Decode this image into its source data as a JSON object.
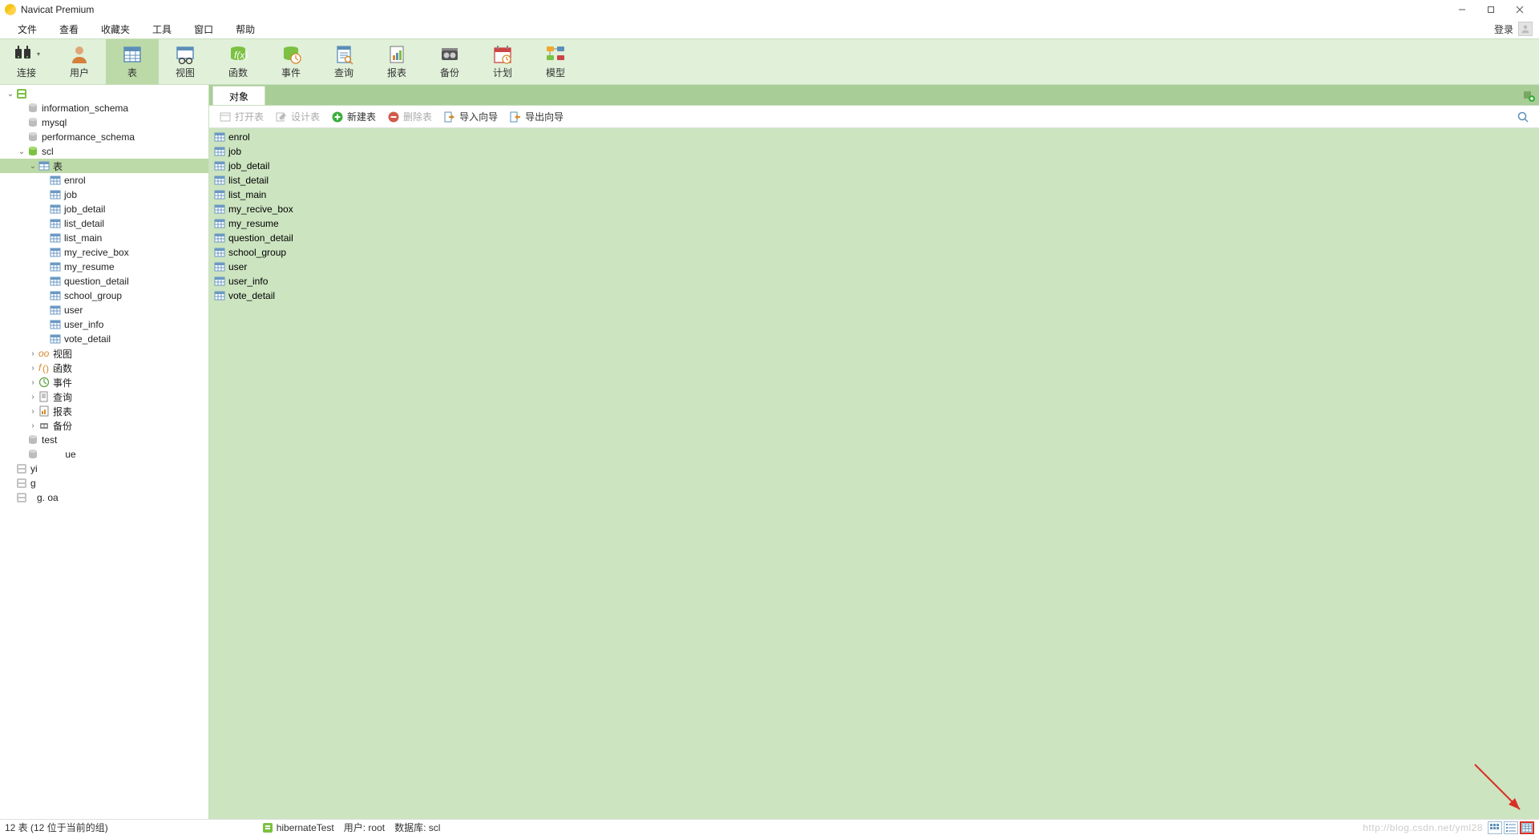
{
  "app_title": "Navicat Premium",
  "menu": [
    "文件",
    "查看",
    "收藏夹",
    "工具",
    "窗口",
    "帮助"
  ],
  "login_label": "登录",
  "toolbar": [
    {
      "id": "connect",
      "label": "连接",
      "has_chev": true
    },
    {
      "id": "user",
      "label": "用户"
    },
    {
      "id": "table",
      "label": "表",
      "active": true
    },
    {
      "id": "view",
      "label": "视图"
    },
    {
      "id": "function",
      "label": "函数"
    },
    {
      "id": "event",
      "label": "事件"
    },
    {
      "id": "query",
      "label": "查询"
    },
    {
      "id": "report",
      "label": "报表"
    },
    {
      "id": "backup",
      "label": "备份"
    },
    {
      "id": "schedule",
      "label": "计划"
    },
    {
      "id": "model",
      "label": "模型"
    }
  ],
  "tree": [
    {
      "depth": 0,
      "exp": "open",
      "icon": "conn-green",
      "label": "",
      "sel": false,
      "redacted": true
    },
    {
      "depth": 1,
      "exp": "none",
      "icon": "db-gray",
      "label": "information_schema"
    },
    {
      "depth": 1,
      "exp": "none",
      "icon": "db-gray",
      "label": "mysql"
    },
    {
      "depth": 1,
      "exp": "none",
      "icon": "db-gray",
      "label": "performance_schema"
    },
    {
      "depth": 1,
      "exp": "open",
      "icon": "db-green",
      "label": "scl"
    },
    {
      "depth": 2,
      "exp": "open",
      "icon": "tablegrp",
      "label": "表",
      "sel": true
    },
    {
      "depth": 3,
      "exp": "none",
      "icon": "table",
      "label": "enrol"
    },
    {
      "depth": 3,
      "exp": "none",
      "icon": "table",
      "label": "job"
    },
    {
      "depth": 3,
      "exp": "none",
      "icon": "table",
      "label": "job_detail"
    },
    {
      "depth": 3,
      "exp": "none",
      "icon": "table",
      "label": "list_detail"
    },
    {
      "depth": 3,
      "exp": "none",
      "icon": "table",
      "label": "list_main"
    },
    {
      "depth": 3,
      "exp": "none",
      "icon": "table",
      "label": "my_recive_box"
    },
    {
      "depth": 3,
      "exp": "none",
      "icon": "table",
      "label": "my_resume"
    },
    {
      "depth": 3,
      "exp": "none",
      "icon": "table",
      "label": "question_detail"
    },
    {
      "depth": 3,
      "exp": "none",
      "icon": "table",
      "label": "school_group"
    },
    {
      "depth": 3,
      "exp": "none",
      "icon": "table",
      "label": "user"
    },
    {
      "depth": 3,
      "exp": "none",
      "icon": "table",
      "label": "user_info"
    },
    {
      "depth": 3,
      "exp": "none",
      "icon": "table",
      "label": "vote_detail"
    },
    {
      "depth": 2,
      "exp": "closed",
      "icon": "view",
      "label": "视图"
    },
    {
      "depth": 2,
      "exp": "closed",
      "icon": "func",
      "label": "函数"
    },
    {
      "depth": 2,
      "exp": "closed",
      "icon": "event",
      "label": "事件"
    },
    {
      "depth": 2,
      "exp": "closed",
      "icon": "query",
      "label": "查询"
    },
    {
      "depth": 2,
      "exp": "closed",
      "icon": "report",
      "label": "报表"
    },
    {
      "depth": 2,
      "exp": "closed",
      "icon": "backup",
      "label": "备份"
    },
    {
      "depth": 1,
      "exp": "none",
      "icon": "db-gray",
      "label": "test"
    },
    {
      "depth": 1,
      "exp": "none",
      "icon": "db-gray",
      "label": "",
      "redacted": true,
      "suffix": "ue"
    },
    {
      "depth": 0,
      "exp": "none",
      "icon": "conn-gray",
      "label": "yi"
    },
    {
      "depth": 0,
      "exp": "none",
      "icon": "conn-gray",
      "label": "g"
    },
    {
      "depth": 0,
      "exp": "none",
      "icon": "conn-gray",
      "label": "g.   oa",
      "redacted": true
    }
  ],
  "tab_label": "对象",
  "objbar": [
    {
      "id": "open",
      "label": "打开表",
      "disabled": true,
      "icon": "open"
    },
    {
      "id": "design",
      "label": "设计表",
      "disabled": true,
      "icon": "design"
    },
    {
      "id": "new",
      "label": "新建表",
      "icon": "plus"
    },
    {
      "id": "delete",
      "label": "删除表",
      "disabled": true,
      "icon": "minus"
    },
    {
      "id": "import",
      "label": "导入向导",
      "icon": "import"
    },
    {
      "id": "export",
      "label": "导出向导",
      "icon": "export"
    }
  ],
  "objects": [
    "enrol",
    "job",
    "job_detail",
    "list_detail",
    "list_main",
    "my_recive_box",
    "my_resume",
    "question_detail",
    "school_group",
    "user",
    "user_info",
    "vote_detail"
  ],
  "status": {
    "left": "12 表 (12 位于当前的组)",
    "connection": "hibernateTest",
    "user_label": "用户: root",
    "db_label": "数据库: scl",
    "watermark": "http://blog.csdn.net/yml28"
  }
}
